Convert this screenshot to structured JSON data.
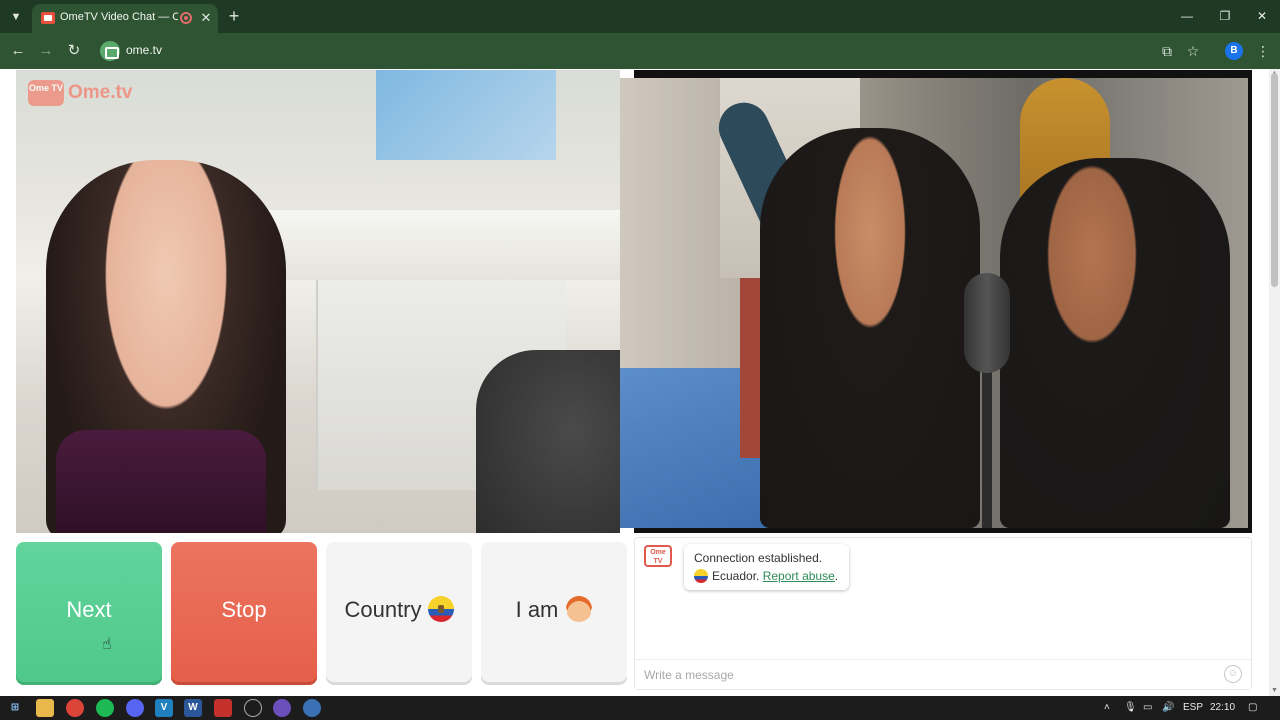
{
  "browser": {
    "tab_title": "OmeTV Video Chat — Ome",
    "tab_close": "✕",
    "new_tab": "+",
    "url": "ome.tv",
    "profile_initial": "B",
    "window_controls": {
      "minimize": "—",
      "maximize": "❐",
      "close": "✕"
    }
  },
  "brand": {
    "badge": "Ome TV",
    "name": "Ome.tv"
  },
  "controls": {
    "next_label": "Next",
    "stop_label": "Stop",
    "country_label": "Country",
    "country_flag_icon": "ecuador-flag-icon",
    "iam_label": "I am",
    "iam_icon": "boy-emoji-icon"
  },
  "chat": {
    "logo": "Ome TV",
    "message_line1": "Connection established.",
    "country": "Ecuador.",
    "report_link": "Report abuse",
    "report_suffix": ".",
    "input_placeholder": "Write a message"
  },
  "taskbar": {
    "language": "ESP",
    "time": "22:10"
  },
  "colors": {
    "next_green": "#55cc91",
    "stop_red": "#e8654f",
    "browser_frame": "#1f3a24",
    "report_link": "#2e8b57"
  }
}
